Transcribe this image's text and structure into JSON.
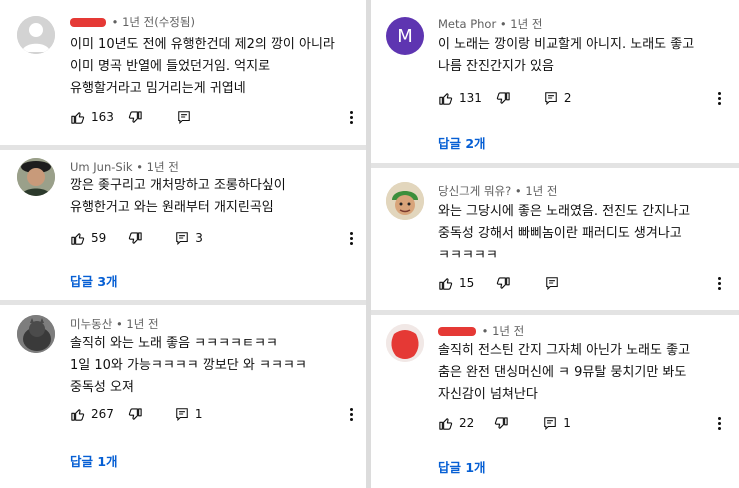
{
  "left": [
    {
      "author": "",
      "time": "• 1년 전(수정됨)",
      "lines": [
        "이미 10년도 전에 유행한건데 제2의 깡이 아니라",
        "이미 명곡 반열에 들었던거임. 억지로",
        "유행할거라고 밈거리는게 귀엽네"
      ],
      "likes": "163",
      "replies": "",
      "reply_label": ""
    },
    {
      "author": "Um Jun-Sik",
      "time": "• 1년 전",
      "lines": [
        "깡은 좆구리고 개처망하고 조롱하다싶이",
        "유행한거고 와는 원래부터 개지린곡임"
      ],
      "likes": "59",
      "replies": "3",
      "reply_label": "답글 3개"
    },
    {
      "author": "미누동산",
      "time": "• 1년 전",
      "lines": [
        "솔직히 와는 노래 좋음 ㅋㅋㅋㅋㅌㅋㅋ",
        "1일 10와 가능ㅋㅋㅋㅋ 깡보단 와 ㅋㅋㅋㅋ",
        "중독성 오져"
      ],
      "likes": "267",
      "replies": "1",
      "reply_label": "답글 1개"
    }
  ],
  "right": [
    {
      "author": "Meta Phor",
      "time": "• 1년 전",
      "avatar_letter": "M",
      "lines": [
        "이 노래는 깡이랑 비교할게 아니지. 노래도 좋고",
        "나름 잔진간지가 있음"
      ],
      "likes": "131",
      "replies": "2",
      "reply_label": "답글 2개"
    },
    {
      "author": "당신그게 뭐유?",
      "time": "• 1년 전",
      "lines": [
        "와는 그당시에 좋은 노래였음. 전진도 간지나고",
        "중독성 강해서 빠삐놈이란 패러디도 생겨나고",
        "ㅋㅋㅋㅋㅋ"
      ],
      "likes": "15",
      "replies": "",
      "reply_label": ""
    },
    {
      "author": "",
      "time": "• 1년 전",
      "lines": [
        "솔직히 전스틴 간지 그자체 아닌가 노래도 좋고",
        "춤은 완전 댄싱머신에 ㅋ 9뮤탈 뭉치기만 봐도",
        "자신감이 넘쳐난다"
      ],
      "likes": "22",
      "replies": "1",
      "reply_label": "답글 1개"
    }
  ],
  "colors": {
    "link": "#065fd4",
    "meta_avatar": "#5e35b1",
    "redact": "#e53935"
  }
}
